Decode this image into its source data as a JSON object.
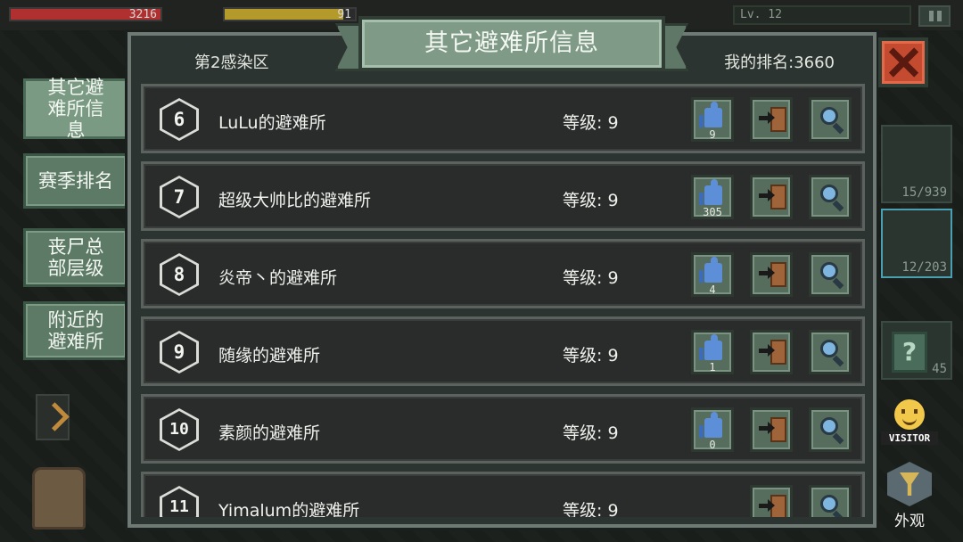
{
  "hud": {
    "health": "3216",
    "food": "91",
    "level": "Lv. 12"
  },
  "side_tabs": [
    {
      "label": "其它避难所信息",
      "active": true
    },
    {
      "label": "赛季排名",
      "active": false
    },
    {
      "label": "丧尸总部层级",
      "active": false
    },
    {
      "label": "附近的避难所",
      "active": false
    }
  ],
  "panel": {
    "title": "其它避难所信息",
    "zone": "第2感染区",
    "my_rank": "我的排名:3660"
  },
  "shelters": [
    {
      "rank": "6",
      "name": "LuLu的避难所",
      "level": "等级: 9",
      "likes": "9"
    },
    {
      "rank": "7",
      "name": "超级大帅比的避难所",
      "level": "等级: 9",
      "likes": "305"
    },
    {
      "rank": "8",
      "name": "炎帝丶的避难所",
      "level": "等级: 9",
      "likes": "4"
    },
    {
      "rank": "9",
      "name": "随缘的避难所",
      "level": "等级: 9",
      "likes": "1"
    },
    {
      "rank": "10",
      "name": "素颜的避难所",
      "level": "等级: 9",
      "likes": "0"
    },
    {
      "rank": "11",
      "name": "Yimalum的避难所",
      "level": "等级: 9",
      "likes": ""
    }
  ],
  "right_slots": {
    "slot1_count": "15/939",
    "slot2_count": "12/203",
    "slot3_count": "45",
    "visitor_label": "VISITOR",
    "appearance_label": "外观"
  },
  "colors": {
    "panel_bg": "#2c3431",
    "tab_green": "#5c7a66",
    "close_red": "#c44b2f",
    "like_blue": "#5d8fd8"
  }
}
